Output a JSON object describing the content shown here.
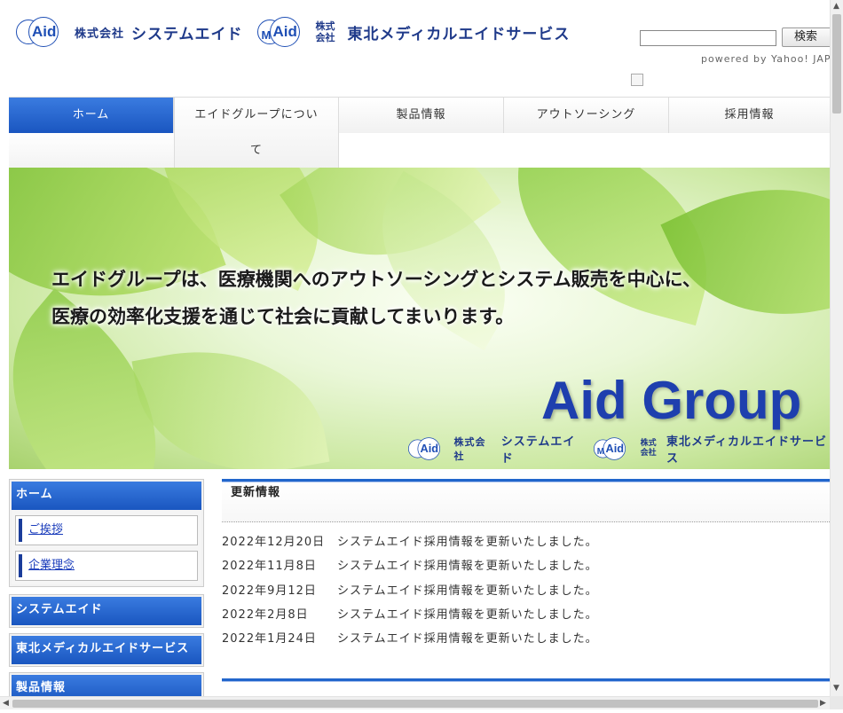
{
  "header": {
    "logo1": {
      "mark": "Aid",
      "kabu": "株式会社",
      "name": "システムエイド"
    },
    "logo2": {
      "mark": "Aid",
      "m": "M",
      "kabu_top": "株式",
      "kabu_bottom": "会社",
      "name": "東北メディカルエイドサービス"
    },
    "search": {
      "button_label": "検索",
      "powered": "powered by Yahoo! JAPAN",
      "value": ""
    }
  },
  "nav": {
    "items": [
      {
        "label": "ホーム",
        "active": true
      },
      {
        "label_line1": "エイドグループについ",
        "label_line2": "て"
      },
      {
        "label": "製品情報"
      },
      {
        "label": "アウトソーシング"
      },
      {
        "label": "採用情報"
      }
    ]
  },
  "hero": {
    "line1": "エイドグループは、医療機関へのアウトソーシングとシステム販売を中心に、",
    "line2": "医療の効率化支援を通じて社会に貢献してまいります。",
    "brand": "Aid Group",
    "logo1": {
      "mark": "Aid",
      "kabu": "株式会社",
      "name": "システムエイド"
    },
    "logo2": {
      "mark": "Aid",
      "m": "M",
      "kabu_top": "株式",
      "kabu_bottom": "会社",
      "name": "東北メディカルエイドサービス"
    }
  },
  "sidebar": {
    "home": {
      "title": "ホーム",
      "links": [
        "ご挨拶",
        "企業理念"
      ]
    },
    "sections": [
      "システムエイド",
      "東北メディカルエイドサービス",
      "製品情報"
    ]
  },
  "news": {
    "title": "更新情報",
    "items": [
      {
        "date": "2022年12月20日",
        "text": "システムエイド採用情報を更新いたしました。"
      },
      {
        "date": "2022年11月8日",
        "text": "システムエイド採用情報を更新いたしました。"
      },
      {
        "date": "2022年9月12日",
        "text": "システムエイド採用情報を更新いたしました。"
      },
      {
        "date": "2022年2月8日",
        "text": "システムエイド採用情報を更新いたしました。"
      },
      {
        "date": "2022年1月24日",
        "text": "システムエイド採用情報を更新いたしました。"
      }
    ]
  },
  "colors": {
    "accent": "#2266cc",
    "brand": "#1f3a8a",
    "nav_active": "#1a56c0"
  }
}
